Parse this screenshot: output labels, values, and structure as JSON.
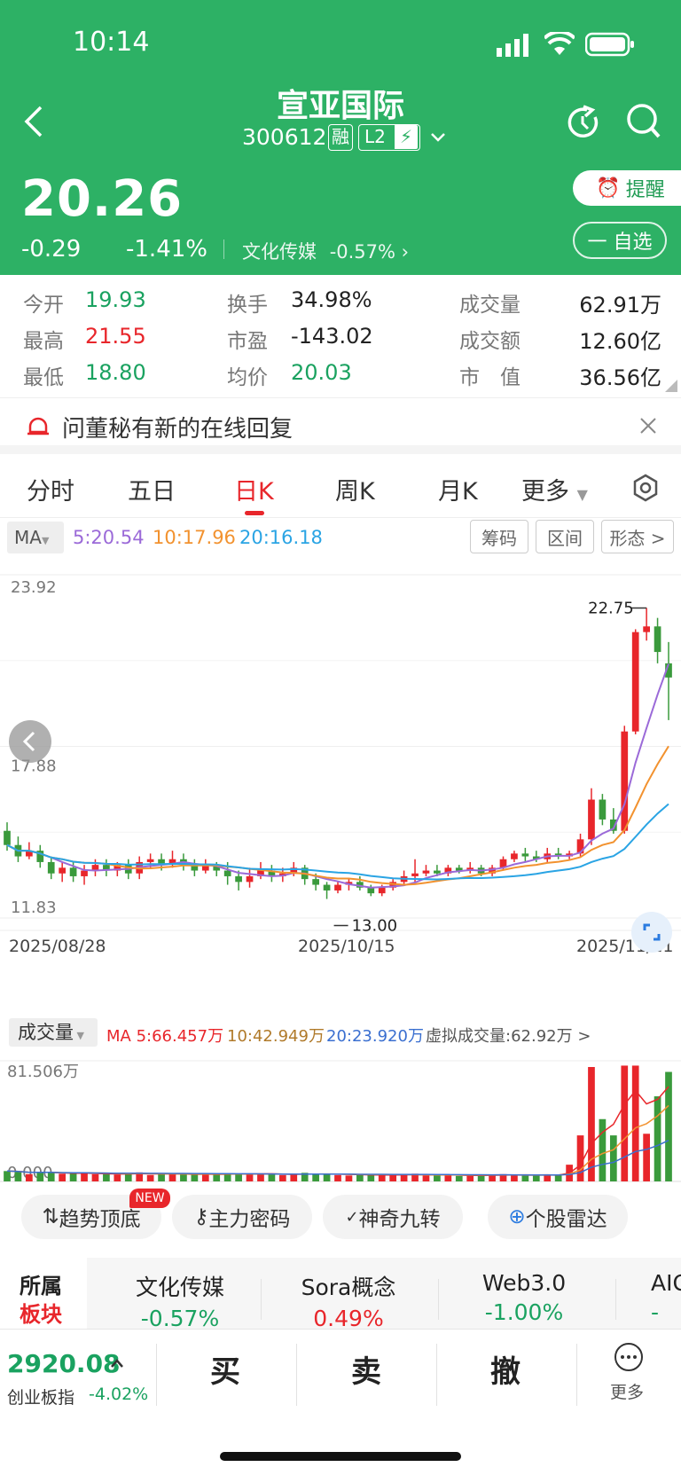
{
  "status": {
    "time": "10:14"
  },
  "stock": {
    "name": "宣亚国际",
    "code": "300612",
    "badge_rong": "融",
    "badge_l2": "L2",
    "price": "20.26",
    "change": "-0.29",
    "change_pct": "-1.41%",
    "sector": "文化传媒",
    "sector_pct": "-0.57%",
    "remind_label": "提醒",
    "watch_label": "一 自选"
  },
  "stats": {
    "open_label": "今开",
    "open": "19.93",
    "high_label": "最高",
    "high": "21.55",
    "low_label": "最低",
    "low": "18.80",
    "turnover_label": "换手",
    "turnover": "34.98%",
    "pe_label": "市盈",
    "pe": "-143.02",
    "avg_label": "均价",
    "avg": "20.03",
    "vol_label": "成交量",
    "vol": "62.91万",
    "amount_label": "成交额",
    "amount": "12.60亿",
    "mcap_label": "市　值",
    "mcap": "36.56亿"
  },
  "notice": {
    "text": "问董秘有新的在线回复"
  },
  "tabs": [
    "分时",
    "五日",
    "日K",
    "周K",
    "月K",
    "更多"
  ],
  "ma": {
    "label": "MA",
    "ma5": "5:20.54",
    "ma10": "10:17.96",
    "ma20": "20:16.18"
  },
  "chart_buttons": [
    "筹码",
    "区间",
    "形态 >"
  ],
  "chart_labels": {
    "y_top": "23.92",
    "y_mid": "17.88",
    "y_bot": "11.83",
    "high_mark": "22.75",
    "low_mark": "13.00",
    "date1": "2025/08/28",
    "date2": "2025/10/15",
    "date3": "2025/11/21"
  },
  "volume": {
    "label": "成交量",
    "ma5": "MA 5:66.457万",
    "ma10": "10:42.949万",
    "ma20": "20:23.920万",
    "virtual": "虚拟成交量:62.92万 >",
    "y_top": "81.506万",
    "y_bot": "0.000"
  },
  "tools": {
    "new_badge": "NEW",
    "t1": "趋势顶底",
    "t2": "主力密码",
    "t3": "神奇九转",
    "t4": "个股雷达"
  },
  "sectors": {
    "title1": "所属",
    "title2": "板块",
    "items": [
      {
        "name": "文化传媒",
        "pct": "-0.57%"
      },
      {
        "name": "Sora概念",
        "pct": "0.49%"
      },
      {
        "name": "Web3.0",
        "pct": "-1.00%"
      },
      {
        "name": "AIG",
        "pct": "-"
      }
    ]
  },
  "bottom": {
    "index_value": "2920.08",
    "index_name": "创业板指",
    "index_pct": "-4.02%",
    "buy": "买",
    "sell": "卖",
    "cancel": "撤",
    "more": "更多"
  },
  "chart_data": {
    "type": "candlestick",
    "y_range": [
      11.83,
      23.92
    ],
    "x_ticks": [
      "2025/08/28",
      "2025/10/15",
      "2025/11/21"
    ],
    "candles": [
      [
        14.9,
        14.4,
        15.2,
        14.2
      ],
      [
        14.4,
        14.0,
        14.7,
        13.8
      ],
      [
        14.0,
        14.2,
        14.5,
        13.9
      ],
      [
        14.2,
        13.8,
        14.4,
        13.6
      ],
      [
        13.8,
        13.4,
        14.0,
        13.2
      ],
      [
        13.4,
        13.6,
        13.8,
        13.1
      ],
      [
        13.6,
        13.3,
        13.8,
        13.1
      ],
      [
        13.3,
        13.5,
        13.7,
        13.0
      ],
      [
        13.5,
        13.7,
        13.9,
        13.3
      ],
      [
        13.7,
        13.5,
        13.9,
        13.3
      ],
      [
        13.5,
        13.7,
        13.8,
        13.3
      ],
      [
        13.7,
        13.4,
        13.9,
        13.2
      ],
      [
        13.4,
        13.8,
        14.0,
        13.2
      ],
      [
        13.8,
        13.9,
        14.1,
        13.6
      ],
      [
        13.9,
        13.7,
        14.1,
        13.5
      ],
      [
        13.7,
        13.9,
        14.2,
        13.6
      ],
      [
        13.9,
        13.7,
        14.1,
        13.5
      ],
      [
        13.7,
        13.5,
        13.9,
        13.3
      ],
      [
        13.5,
        13.7,
        13.9,
        13.4
      ],
      [
        13.7,
        13.5,
        13.8,
        13.3
      ],
      [
        13.5,
        13.3,
        13.8,
        13.0
      ],
      [
        13.3,
        13.1,
        13.5,
        12.8
      ],
      [
        13.1,
        13.3,
        13.6,
        12.9
      ],
      [
        13.3,
        13.5,
        13.8,
        13.2
      ],
      [
        13.5,
        13.3,
        13.7,
        13.1
      ],
      [
        13.3,
        13.4,
        13.6,
        13.1
      ],
      [
        13.4,
        13.6,
        13.8,
        13.3
      ],
      [
        13.6,
        13.2,
        13.7,
        13.0
      ],
      [
        13.2,
        13.0,
        13.4,
        12.8
      ],
      [
        13.0,
        12.8,
        13.1,
        12.5
      ],
      [
        12.8,
        13.0,
        13.1,
        12.7
      ],
      [
        13.0,
        13.1,
        13.2,
        12.8
      ],
      [
        13.1,
        12.9,
        13.3,
        12.8
      ],
      [
        12.9,
        12.7,
        13.0,
        12.6
      ],
      [
        12.7,
        12.9,
        13.0,
        12.6
      ],
      [
        12.9,
        13.1,
        13.2,
        12.8
      ],
      [
        13.1,
        13.3,
        13.5,
        13.0
      ],
      [
        13.3,
        13.4,
        13.9,
        13.1
      ],
      [
        13.4,
        13.5,
        13.7,
        13.3
      ],
      [
        13.5,
        13.4,
        13.7,
        13.3
      ],
      [
        13.4,
        13.6,
        13.7,
        13.3
      ],
      [
        13.6,
        13.5,
        13.7,
        13.4
      ],
      [
        13.5,
        13.6,
        13.8,
        13.4
      ],
      [
        13.6,
        13.4,
        13.7,
        13.3
      ],
      [
        13.4,
        13.6,
        13.7,
        13.3
      ],
      [
        13.6,
        13.9,
        14.0,
        13.5
      ],
      [
        13.9,
        14.1,
        14.2,
        13.8
      ],
      [
        14.1,
        14.0,
        14.3,
        13.8
      ],
      [
        14.0,
        13.9,
        14.2,
        13.8
      ],
      [
        13.9,
        14.1,
        14.3,
        13.8
      ],
      [
        14.1,
        14.0,
        14.3,
        13.9
      ],
      [
        14.0,
        14.1,
        14.2,
        13.9
      ],
      [
        14.1,
        14.6,
        14.8,
        14.0
      ],
      [
        14.6,
        16.0,
        16.4,
        14.4
      ],
      [
        16.0,
        15.3,
        16.2,
        15.1
      ],
      [
        15.3,
        14.9,
        15.7,
        14.8
      ],
      [
        14.9,
        18.4,
        18.6,
        14.8
      ],
      [
        18.4,
        21.9,
        22.0,
        18.3
      ],
      [
        21.9,
        22.1,
        22.75,
        21.6
      ],
      [
        22.1,
        21.2,
        22.4,
        20.8
      ],
      [
        20.8,
        20.3,
        21.55,
        18.8
      ]
    ]
  }
}
